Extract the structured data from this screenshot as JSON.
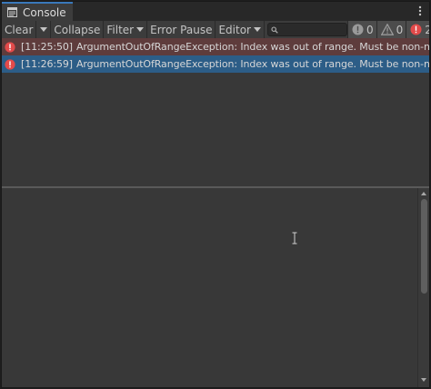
{
  "window": {
    "tab_label": "Console",
    "tab_icon": "console-icon",
    "menu_icon": "kebab-menu-icon"
  },
  "toolbar": {
    "clear_label": "Clear",
    "collapse_label": "Collapse",
    "filter_label": "Filter",
    "error_pause_label": "Error Pause",
    "editor_label": "Editor",
    "search_placeholder": "",
    "search_value": "",
    "info_count": "0",
    "warning_count": "0",
    "error_count": "2",
    "hidden_icon": "eye-slash-icon"
  },
  "logs": [
    {
      "timestamp": "[11:25:50]",
      "message": "ArgumentOutOfRangeException: Index was out of range. Must be non-negative a",
      "level": "error",
      "selected": false
    },
    {
      "timestamp": "[11:26:59]",
      "message": "ArgumentOutOfRangeException: Index was out of range. Must be non-negative a",
      "level": "error",
      "selected": true
    }
  ],
  "colors": {
    "tab_accent": "#3a79bb",
    "error_red": "#e24a4a",
    "row_even": "#5e3c3c",
    "row_selected": "#2c5d87"
  }
}
